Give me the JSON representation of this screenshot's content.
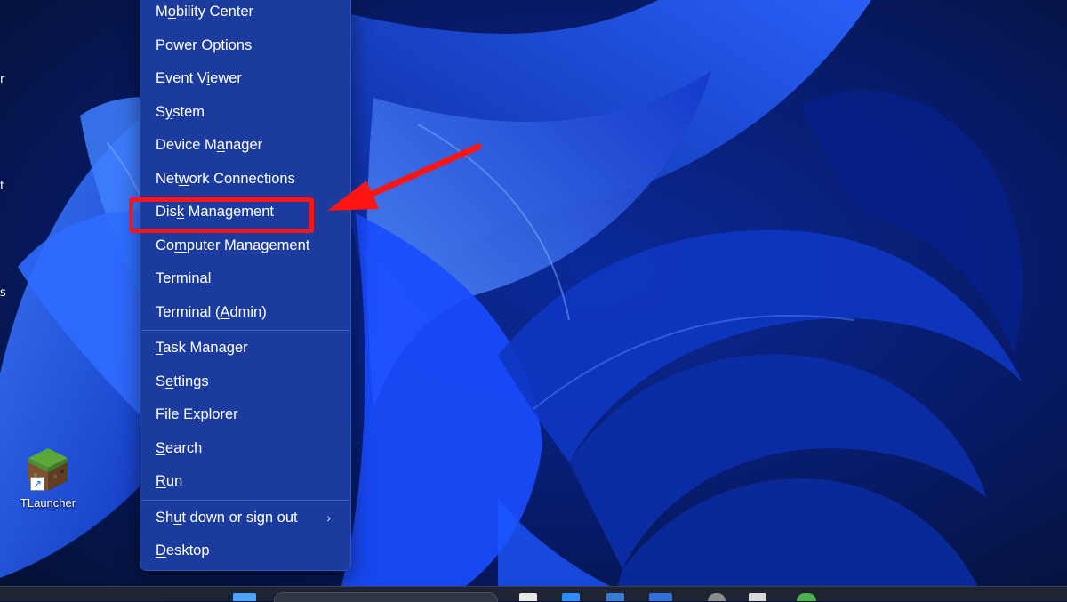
{
  "desktop": {
    "edge_labels": [
      "r",
      "t",
      "s"
    ],
    "shortcuts": [
      {
        "label": "TLauncher",
        "icon": "minecraft-grass-block-icon"
      }
    ]
  },
  "menu": {
    "groups": [
      [
        {
          "label": "Mobility Center",
          "accel_index": 1
        },
        {
          "label": "Power Options",
          "accel_index": 7
        },
        {
          "label": "Event Viewer",
          "accel_index": 7
        },
        {
          "label": "System",
          "accel_index": 1
        },
        {
          "label": "Device Manager",
          "accel_index": 8
        },
        {
          "label": "Network Connections",
          "accel_index": 3
        },
        {
          "label": "Disk Management",
          "accel_index": 3
        },
        {
          "label": "Computer Management",
          "accel_index": 2
        },
        {
          "label": "Terminal",
          "accel_index": 6
        },
        {
          "label": "Terminal (Admin)",
          "accel_index": 10
        }
      ],
      [
        {
          "label": "Task Manager",
          "accel_index": 0
        },
        {
          "label": "Settings",
          "accel_index": 1
        },
        {
          "label": "File Explorer",
          "accel_index": 6
        },
        {
          "label": "Search",
          "accel_index": 0
        },
        {
          "label": "Run",
          "accel_index": 0
        }
      ],
      [
        {
          "label": "Shut down or sign out",
          "accel_index": 2,
          "submenu": true
        },
        {
          "label": "Desktop",
          "accel_index": 0
        }
      ]
    ],
    "chevron_icon": "chevron-right-icon"
  },
  "annotation": {
    "highlighted_item": "Disk Management",
    "highlight_color": "#ff1414",
    "arrow_color": "#ff1414"
  },
  "colors": {
    "menu_bg": "#1b3c9e",
    "wallpaper_dark": "#05123a",
    "wallpaper_bright": "#1f5bff",
    "taskbar": "#1f2433"
  }
}
